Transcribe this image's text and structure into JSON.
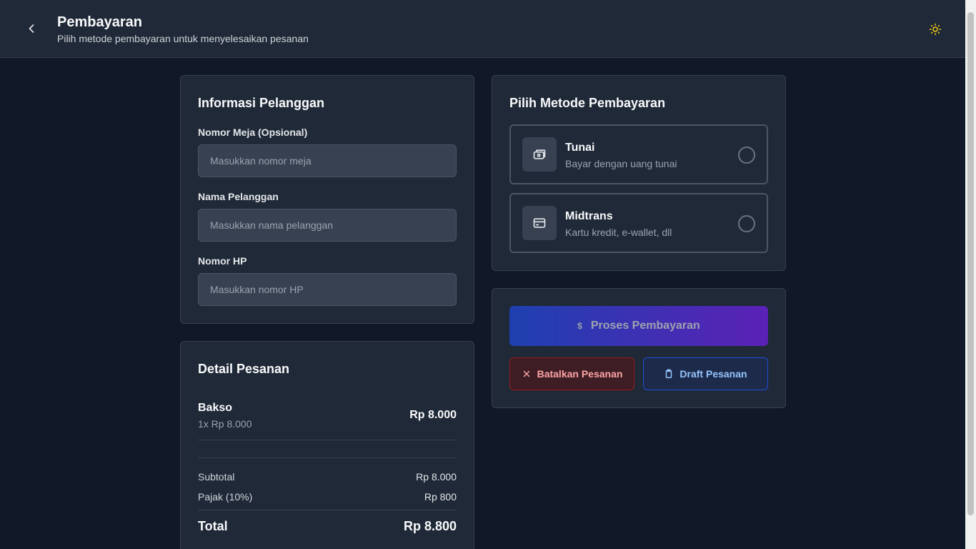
{
  "header": {
    "title": "Pembayaran",
    "subtitle": "Pilih metode pembayaran untuk menyelesaikan pesanan"
  },
  "customer": {
    "title": "Informasi Pelanggan",
    "table": {
      "label": "Nomor Meja (Opsional)",
      "placeholder": "Masukkan nomor meja",
      "value": ""
    },
    "name": {
      "label": "Nama Pelanggan",
      "placeholder": "Masukkan nama pelanggan",
      "value": ""
    },
    "phone": {
      "label": "Nomor HP",
      "placeholder": "Masukkan nomor HP",
      "value": ""
    }
  },
  "payment": {
    "title": "Pilih Metode Pembayaran",
    "options": [
      {
        "name": "Tunai",
        "desc": "Bayar dengan uang tunai",
        "icon": "cash-icon",
        "selected": false
      },
      {
        "name": "Midtrans",
        "desc": "Kartu kredit, e-wallet, dll",
        "icon": "credit-card-icon",
        "selected": false
      }
    ]
  },
  "actions": {
    "process_symbol": "$",
    "process_label": "Proses Pembayaran",
    "cancel_label": "Batalkan Pesanan",
    "draft_label": "Draft Pesanan"
  },
  "order": {
    "title": "Detail Pesanan",
    "items": [
      {
        "name": "Bakso",
        "qty": "1x Rp 8.000",
        "price": "Rp 8.000"
      }
    ],
    "subtotal_label": "Subtotal",
    "subtotal": "Rp 8.000",
    "tax_label": "Pajak (10%)",
    "tax": "Rp 800",
    "total_label": "Total",
    "total": "Rp 8.800"
  },
  "colors": {
    "background": "#111827",
    "card": "#1f2937",
    "accent_gradient_start": "#1e40af",
    "accent_gradient_end": "#5b21b6",
    "danger": "#991b1b",
    "info": "#1d4ed8",
    "theme_icon": "#facc15"
  }
}
